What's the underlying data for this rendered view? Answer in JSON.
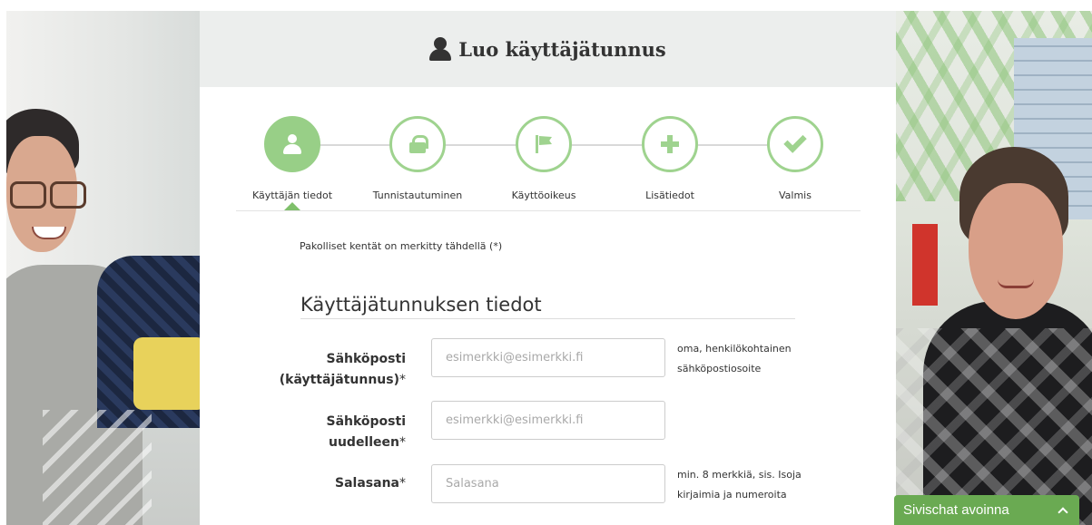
{
  "header": {
    "title": "Luo käyttäjätunnus",
    "icon": "user-icon"
  },
  "stepper": {
    "steps": [
      {
        "label": "Käyttäjän tiedot",
        "icon": "user-icon",
        "active": true
      },
      {
        "label": "Tunnistautuminen",
        "icon": "lock-icon",
        "active": false
      },
      {
        "label": "Käyttöoikeus",
        "icon": "flag-icon",
        "active": false
      },
      {
        "label": "Lisätiedot",
        "icon": "plus-icon",
        "active": false
      },
      {
        "label": "Valmis",
        "icon": "check-icon",
        "active": false
      }
    ]
  },
  "form": {
    "required_note": "Pakolliset kentät on merkitty tähdellä (*)",
    "section_title": "Käyttäjätunnuksen tiedot",
    "fields": [
      {
        "label_line1": "Sähköposti",
        "label_line2": "(käyttäjätunnus)",
        "required_mark": "*",
        "placeholder": "esimerkki@esimerkki.fi",
        "value": "",
        "hint": "oma, henkilökohtainen sähköpostiosoite"
      },
      {
        "label_line1": "Sähköposti",
        "label_line2": "uudelleen",
        "required_mark": "*",
        "placeholder": "esimerkki@esimerkki.fi",
        "value": "",
        "hint": ""
      },
      {
        "label_line1": "Salasana",
        "label_line2": "",
        "required_mark": "*",
        "placeholder": "Salasana",
        "value": "",
        "hint": "min. 8 merkkiä, sis. Isoja kirjaimia ja numeroita"
      }
    ]
  },
  "chat": {
    "label": "Sivischat avoinna"
  },
  "colors": {
    "accent_green": "#98cf87",
    "chat_green": "#6aaa52",
    "header_bg": "#eceeed"
  }
}
